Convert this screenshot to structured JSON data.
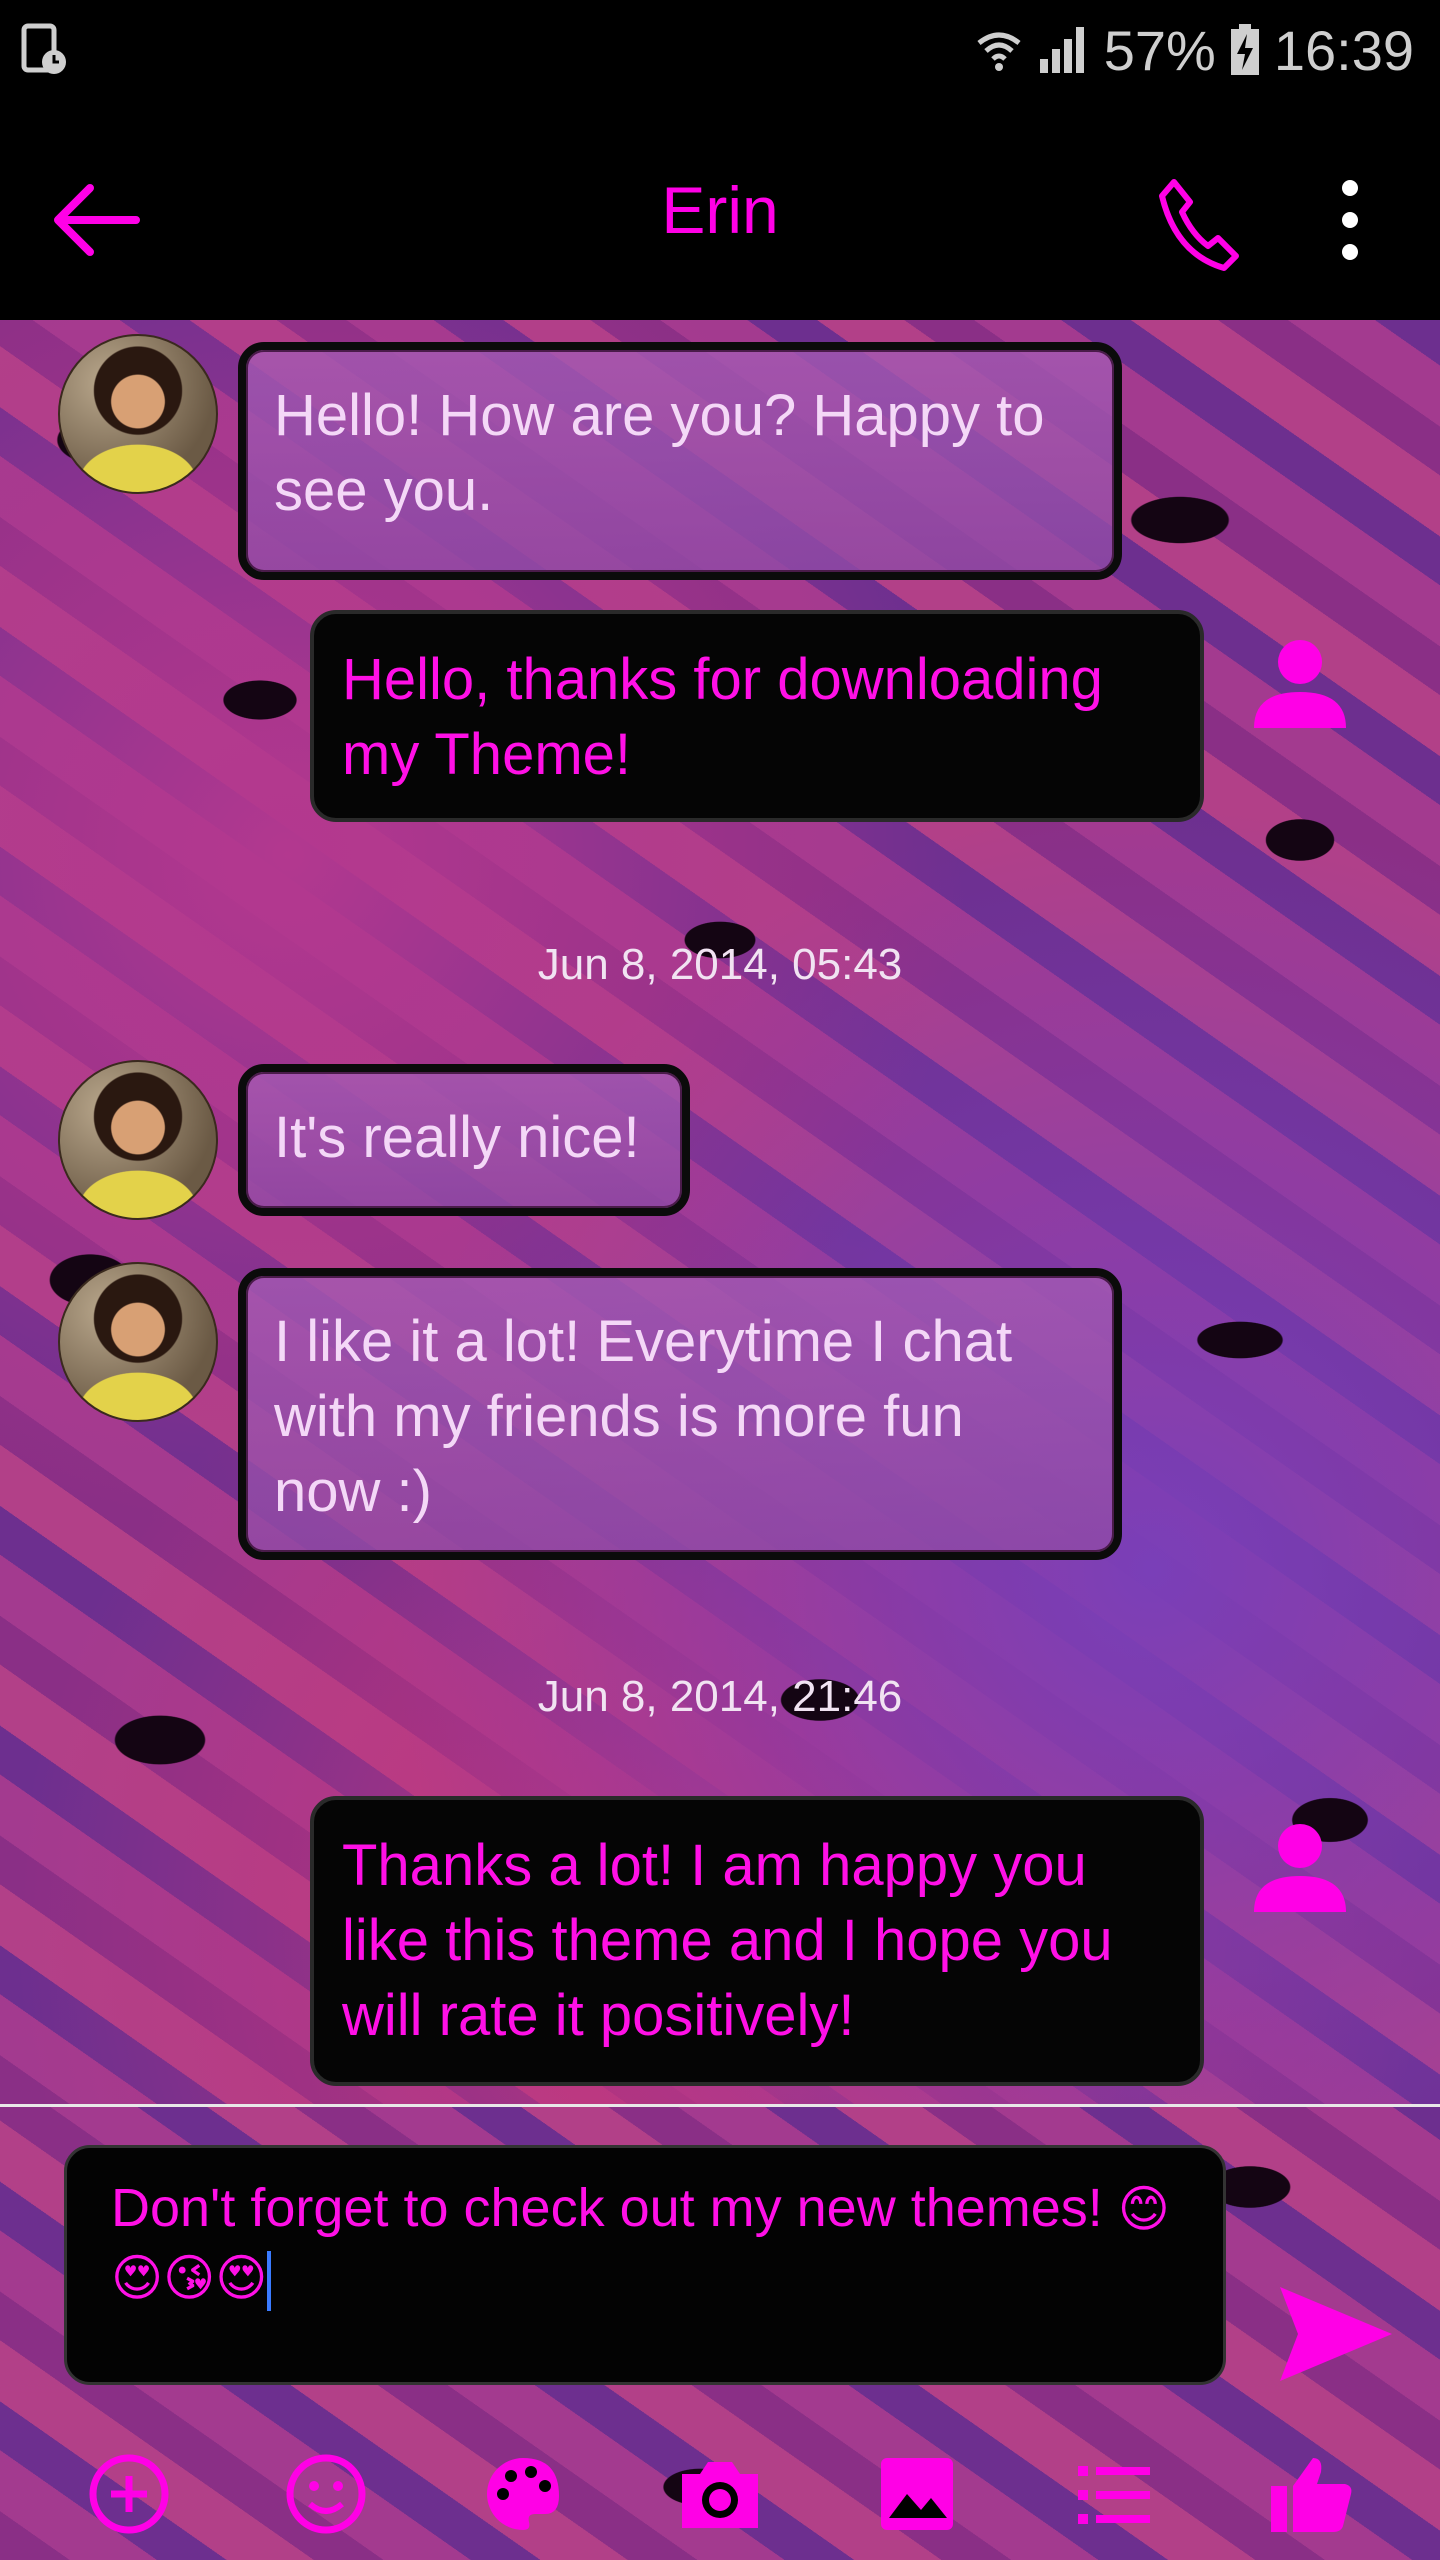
{
  "status_bar": {
    "battery_percent": "57%",
    "time": "16:39"
  },
  "header": {
    "contact_name": "Erin"
  },
  "messages": [
    {
      "direction": "incoming",
      "text": "Hello! How are you? Happy to see you."
    },
    {
      "direction": "outgoing",
      "text": "Hello, thanks for downloading my Theme!"
    },
    {
      "direction": "timestamp",
      "text": "Jun 8, 2014, 05:43"
    },
    {
      "direction": "incoming",
      "text": "It's really nice!"
    },
    {
      "direction": "incoming",
      "text": "I like it a lot! Everytime I chat with my friends is more fun now :)"
    },
    {
      "direction": "timestamp",
      "text": "Jun 8, 2014, 21:46"
    },
    {
      "direction": "outgoing",
      "text": "Thanks a lot! I am happy you like this theme and I hope you will rate it positively!"
    }
  ],
  "compose": {
    "value": "Don't forget to check out my new themes!",
    "emojis": [
      "😊",
      "😍",
      "😘",
      "😍"
    ]
  },
  "toolbar": {
    "icons": [
      "add-icon",
      "emoji-icon",
      "palette-icon",
      "camera-icon",
      "image-icon",
      "list-icon",
      "thumbs-up-icon"
    ]
  },
  "colors": {
    "accent": "#ff00e6",
    "incoming_text": "#f4d8f7",
    "background": "#000000"
  }
}
